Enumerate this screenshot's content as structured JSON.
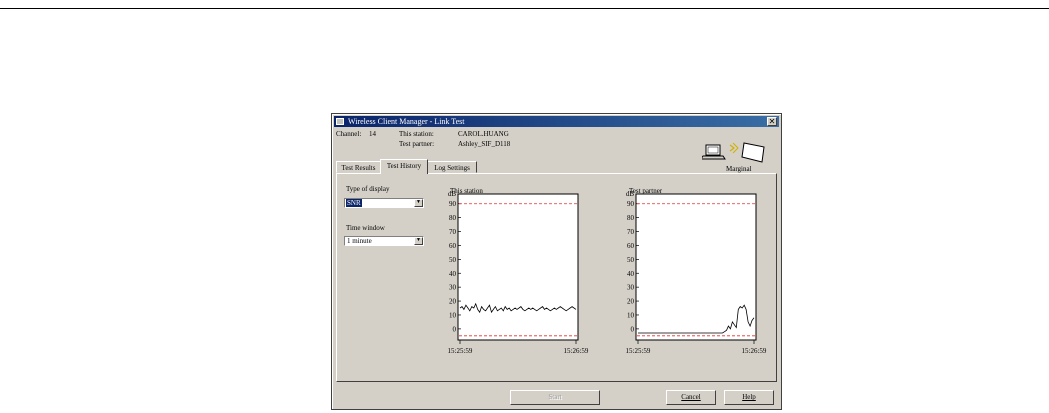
{
  "window": {
    "title": "Wireless Client Manager - Link Test",
    "close_icon": "✕"
  },
  "info": {
    "channel_label": "Channel:",
    "channel_value": "14",
    "this_station_label": "This station:",
    "this_station_value": "CAROL.HUANG",
    "test_partner_label": "Test partner:",
    "test_partner_value": "Ashley_SIF_D118"
  },
  "link_quality": "Marginal",
  "tabs": [
    {
      "label": "Test Results",
      "active": false
    },
    {
      "label": "Test History",
      "active": true
    },
    {
      "label": "Log Settings",
      "active": false
    }
  ],
  "controls": {
    "type_of_display_label": "Type of display",
    "type_of_display_value": "SNR",
    "time_window_label": "Time window",
    "time_window_value": "1 minute"
  },
  "charts": {
    "unit_label": "dB",
    "y_ticks": [
      90,
      80,
      70,
      60,
      50,
      40,
      30,
      20,
      10,
      0
    ],
    "this_station_title": "This station",
    "test_partner_title": "Test partner",
    "x_start": "15:25:59",
    "x_end": "15:26:59",
    "threshold_color": "#e03030"
  },
  "chart_data": [
    {
      "type": "line",
      "title": "This station",
      "ylabel": "dB",
      "ylim": [
        -8,
        97
      ],
      "x_start": "15:25:59",
      "x_end": "15:26:59",
      "threshold_lines": [
        90,
        -5
      ],
      "values": [
        15,
        16,
        14,
        17,
        15,
        13,
        16,
        15,
        18,
        14,
        12,
        16,
        14,
        13,
        15,
        17,
        12,
        14,
        16,
        13,
        14,
        15,
        13,
        16,
        14,
        15,
        13,
        14,
        15,
        14,
        15,
        16,
        14,
        13,
        14,
        15,
        14,
        15,
        14,
        13,
        14,
        15,
        16,
        14,
        15,
        14,
        13,
        14,
        15,
        14,
        15,
        16,
        15,
        14,
        13,
        14,
        15,
        16,
        15,
        14
      ]
    },
    {
      "type": "line",
      "title": "Test partner",
      "ylabel": "dB",
      "ylim": [
        -8,
        97
      ],
      "x_start": "15:25:59",
      "x_end": "15:26:59",
      "threshold_lines": [
        90,
        -5
      ],
      "values": [
        -3,
        -3,
        -3,
        -3,
        -3,
        -3,
        -3,
        -3,
        -3,
        -3,
        -3,
        -3,
        -3,
        -3,
        -3,
        -3,
        -3,
        -3,
        -3,
        -3,
        -3,
        -3,
        -3,
        -3,
        -3,
        -3,
        -3,
        -3,
        -3,
        -3,
        -3,
        -3,
        -3,
        -3,
        -3,
        -3,
        -3,
        -3,
        -3,
        -3,
        -3,
        -3,
        -3,
        -3,
        -2,
        -1,
        2,
        0,
        5,
        3,
        1,
        14,
        16,
        15,
        17,
        14,
        5,
        2,
        6,
        8
      ]
    }
  ],
  "buttons": {
    "start": "Start",
    "cancel": "Cancel",
    "help": "Help"
  }
}
